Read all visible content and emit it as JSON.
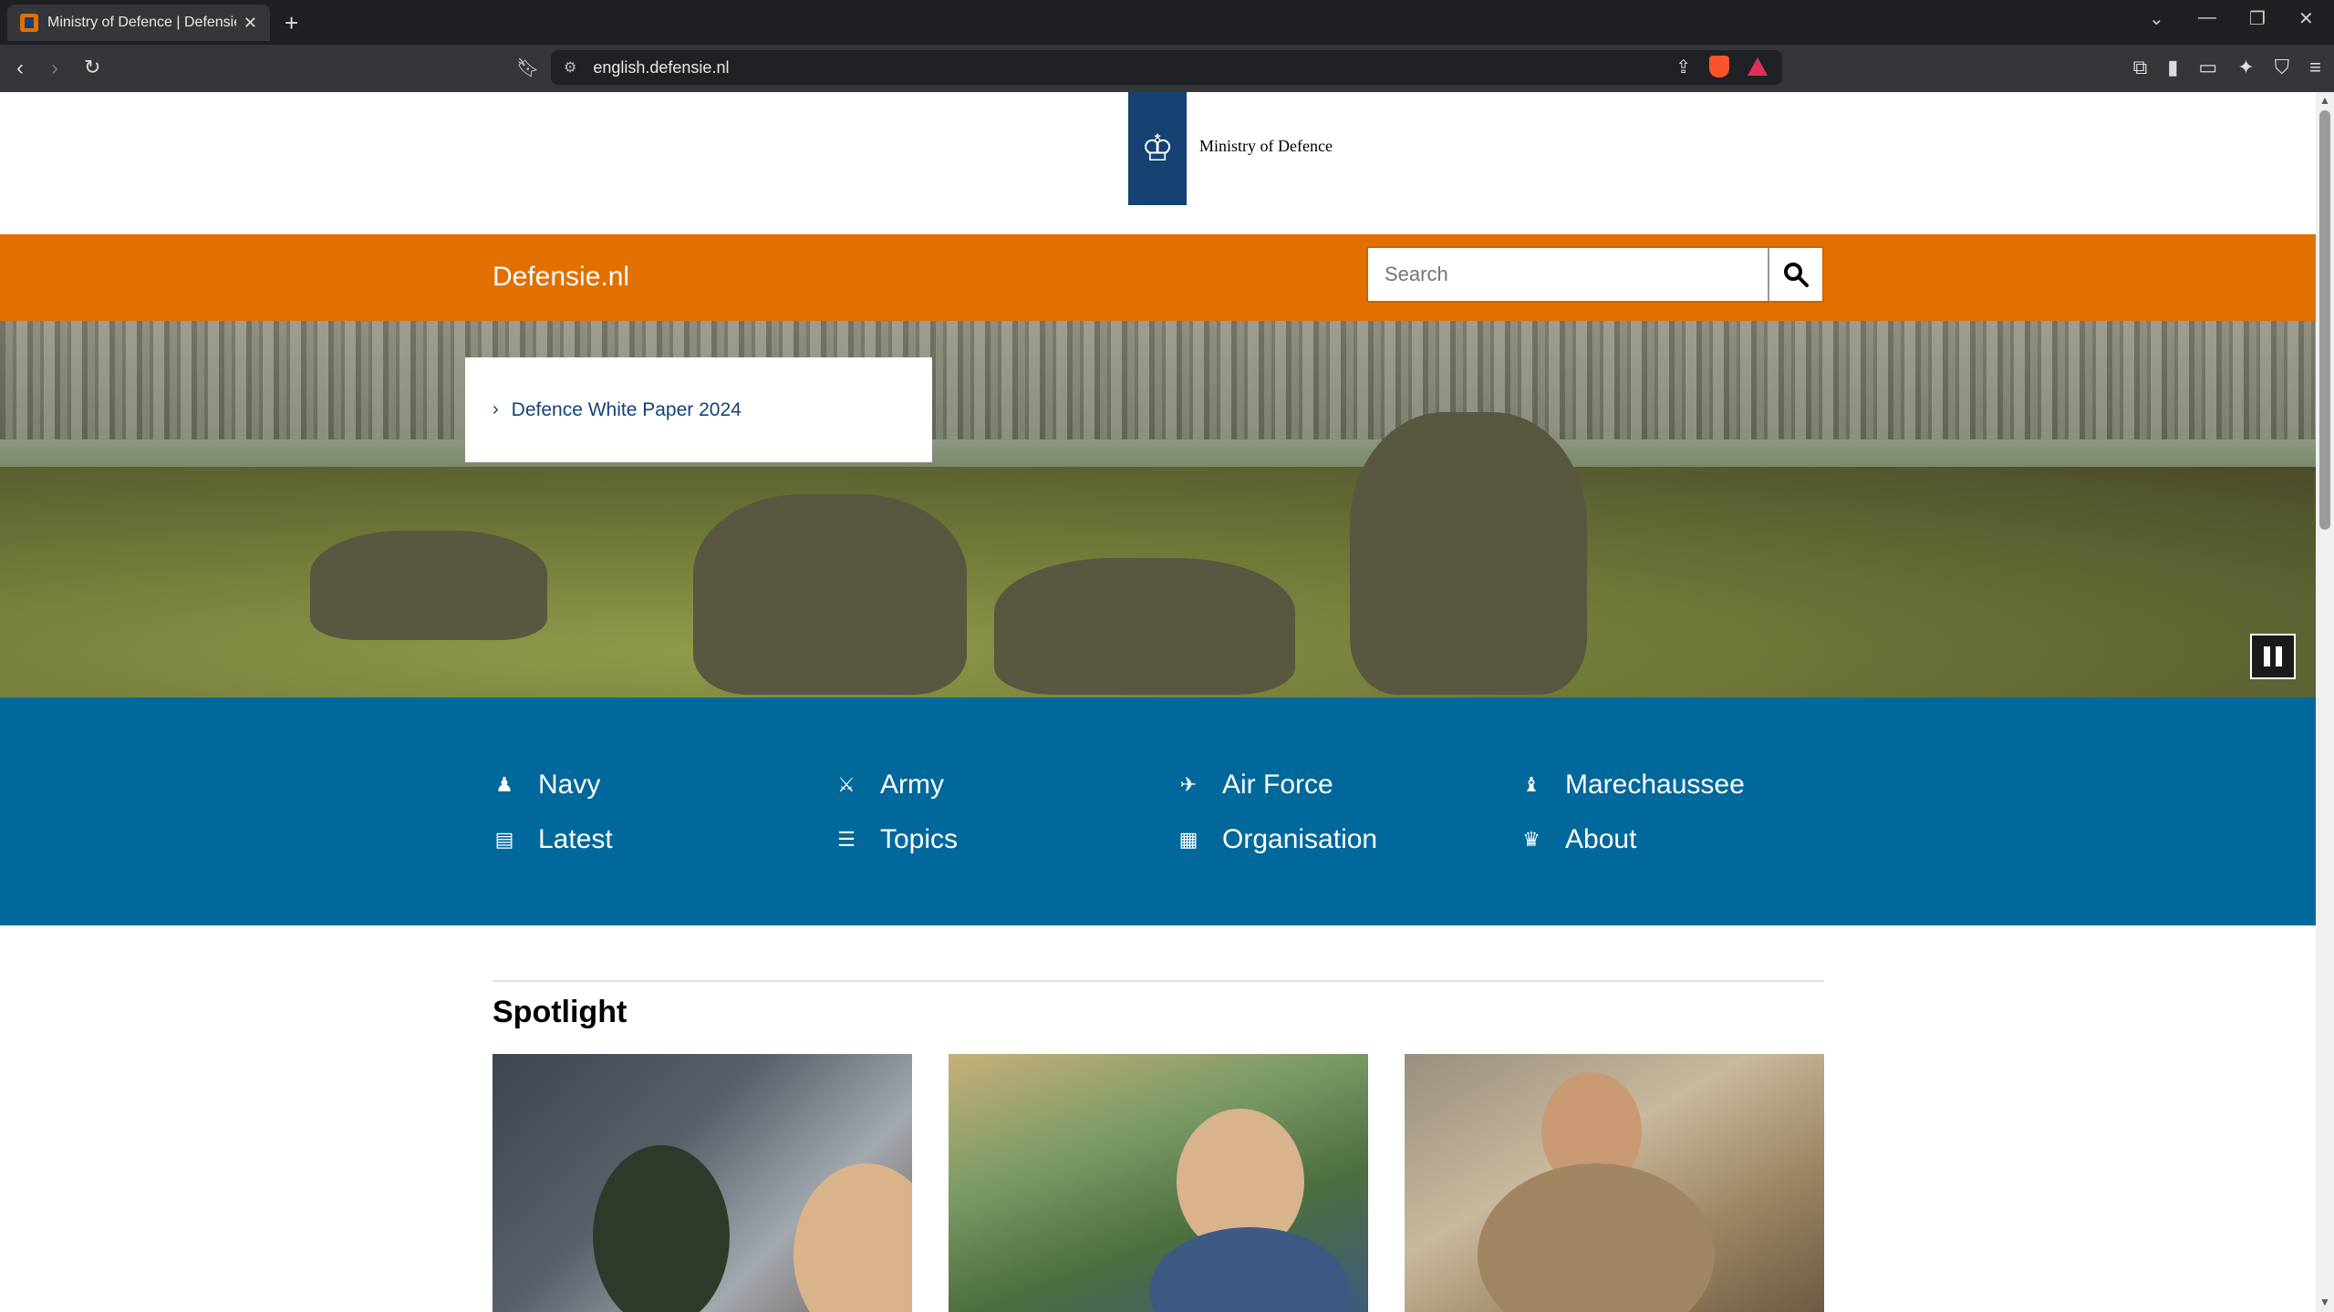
{
  "browser": {
    "tab_title": "Ministry of Defence | Defensie.nl",
    "url": "english.defensie.nl"
  },
  "header": {
    "org_name": "Ministry of Defence",
    "site_name": "Defensie.nl",
    "search_placeholder": "Search"
  },
  "hero": {
    "link_label": "Defence White Paper 2024"
  },
  "main_nav": [
    {
      "label": "Navy",
      "icon": "navy-icon"
    },
    {
      "label": "Army",
      "icon": "army-icon"
    },
    {
      "label": "Air Force",
      "icon": "air-force-icon"
    },
    {
      "label": "Marechaussee",
      "icon": "marechaussee-icon"
    },
    {
      "label": "Latest",
      "icon": "newspaper-icon"
    },
    {
      "label": "Topics",
      "icon": "list-icon"
    },
    {
      "label": "Organisation",
      "icon": "building-icon"
    },
    {
      "label": "About",
      "icon": "coat-of-arms-icon"
    }
  ],
  "spotlight": {
    "title": "Spotlight"
  },
  "colors": {
    "orange": "#e17000",
    "blue": "#01689b",
    "navy": "#154273"
  }
}
